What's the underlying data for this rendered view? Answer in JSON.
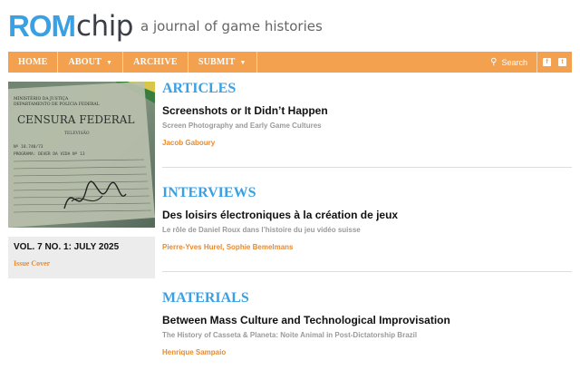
{
  "header": {
    "logo_rom": "ROM",
    "logo_chip": "chip",
    "tagline": "a journal of game histories"
  },
  "nav": {
    "items": [
      {
        "label": "HOME",
        "has_dropdown": false
      },
      {
        "label": "ABOUT",
        "has_dropdown": true
      },
      {
        "label": "ARCHIVE",
        "has_dropdown": false
      },
      {
        "label": "SUBMIT",
        "has_dropdown": true
      }
    ],
    "search_placeholder": "Search",
    "social_icons": [
      "facebook-icon",
      "twitter-icon"
    ]
  },
  "sidebar": {
    "cover_text": {
      "ministry": "MINISTÉRIO DA JUSTIÇA",
      "department": "DEPARTAMENTO DE POLÍCIA FEDERAL",
      "censura": "CENSURA FEDERAL",
      "televisao": "TELEVISÃO",
      "line1": "Nº 18.740/73",
      "line2": "PROGRAMA: DEVER DA VIDA Nº 13"
    },
    "issue_title": "VOL. 7 NO. 1: JULY 2025",
    "issue_link": "Issue Cover"
  },
  "sections": [
    {
      "heading": "ARTICLES",
      "title": "Screenshots or It Didn’t Happen",
      "subtitle": "Screen Photography and Early Game Cultures",
      "author": "Jacob Gaboury"
    },
    {
      "heading": "INTERVIEWS",
      "title": "Des loisirs électroniques à la création de jeux",
      "subtitle": "Le rôle de Daniel Roux dans l’histoire du jeu vidéo suisse",
      "author": "Pierre-Yves Hurel, Sophie Bemelmans"
    },
    {
      "heading": "MATERIALS",
      "title": "Between Mass Culture and Technological Improvisation",
      "subtitle": "The History of Casseta & Planeta: Noite Animal in Post-Dictatorship Brazil",
      "author": "Henrique Sampaio"
    }
  ],
  "colors": {
    "brand_blue": "#3aa0e4",
    "nav_orange": "#f3a14f",
    "author_orange": "#e88a2e"
  }
}
